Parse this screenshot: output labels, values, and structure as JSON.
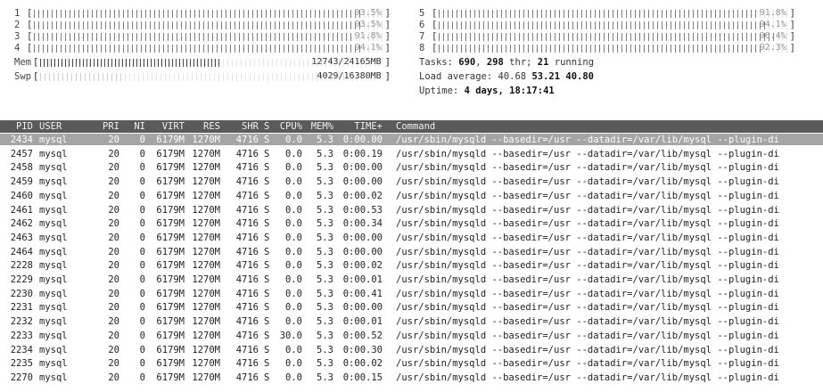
{
  "cpus": [
    {
      "id": "1",
      "pct": "93.5%",
      "fill": 0.935
    },
    {
      "id": "2",
      "pct": "93.5%",
      "fill": 0.935
    },
    {
      "id": "3",
      "pct": "91.8%",
      "fill": 0.918
    },
    {
      "id": "4",
      "pct": "94.1%",
      "fill": 0.941
    },
    {
      "id": "5",
      "pct": "91.8%",
      "fill": 0.918
    },
    {
      "id": "6",
      "pct": "94.1%",
      "fill": 0.941
    },
    {
      "id": "7",
      "pct": "96.4%",
      "fill": 0.964
    },
    {
      "id": "8",
      "pct": "92.3%",
      "fill": 0.923
    }
  ],
  "mem": {
    "label": "Mem",
    "value": "12743/24165MB",
    "fill": 0.527
  },
  "swp": {
    "label": "Swp",
    "value": "4029/16380MB",
    "fill": 0.246
  },
  "tasks": {
    "prefix": "Tasks: ",
    "count": "690",
    "sep": ", ",
    "threads": "298",
    "thr": " thr; ",
    "running": "21",
    "running_label": " running"
  },
  "load": {
    "prefix": "Load average: ",
    "l1": "40.68",
    "l5": "53.21",
    "l15": "40.80"
  },
  "uptime": {
    "prefix": "Uptime: ",
    "value": "4 days, 18:17:41"
  },
  "columns": {
    "pid": "PID",
    "user": "USER",
    "pri": "PRI",
    "ni": "NI",
    "virt": "VIRT",
    "res": "RES",
    "shr": "SHR",
    "s": "S",
    "cpu": "CPU%",
    "mem": "MEM%",
    "time": "TIME+",
    "cmd": "Command"
  },
  "processes": [
    {
      "pid": "2434",
      "user": "mysql",
      "pri": "20",
      "ni": "0",
      "virt": "6179M",
      "res": "1270M",
      "shr": "4716",
      "s": "S",
      "cpu": "0.0",
      "mem": "5.3",
      "time": "0:00.00",
      "cmd": "/usr/sbin/mysqld --basedir=/usr --datadir=/var/lib/mysql --plugin-di"
    },
    {
      "pid": "2457",
      "user": "mysql",
      "pri": "20",
      "ni": "0",
      "virt": "6179M",
      "res": "1270M",
      "shr": "4716",
      "s": "S",
      "cpu": "0.0",
      "mem": "5.3",
      "time": "0:00.19",
      "cmd": "/usr/sbin/mysqld --basedir=/usr --datadir=/var/lib/mysql --plugin-di"
    },
    {
      "pid": "2458",
      "user": "mysql",
      "pri": "20",
      "ni": "0",
      "virt": "6179M",
      "res": "1270M",
      "shr": "4716",
      "s": "S",
      "cpu": "0.0",
      "mem": "5.3",
      "time": "0:00.00",
      "cmd": "/usr/sbin/mysqld --basedir=/usr --datadir=/var/lib/mysql --plugin-di"
    },
    {
      "pid": "2459",
      "user": "mysql",
      "pri": "20",
      "ni": "0",
      "virt": "6179M",
      "res": "1270M",
      "shr": "4716",
      "s": "S",
      "cpu": "0.0",
      "mem": "5.3",
      "time": "0:00.00",
      "cmd": "/usr/sbin/mysqld --basedir=/usr --datadir=/var/lib/mysql --plugin-di"
    },
    {
      "pid": "2460",
      "user": "mysql",
      "pri": "20",
      "ni": "0",
      "virt": "6179M",
      "res": "1270M",
      "shr": "4716",
      "s": "S",
      "cpu": "0.0",
      "mem": "5.3",
      "time": "0:00.02",
      "cmd": "/usr/sbin/mysqld --basedir=/usr --datadir=/var/lib/mysql --plugin-di"
    },
    {
      "pid": "2461",
      "user": "mysql",
      "pri": "20",
      "ni": "0",
      "virt": "6179M",
      "res": "1270M",
      "shr": "4716",
      "s": "S",
      "cpu": "0.0",
      "mem": "5.3",
      "time": "0:00.53",
      "cmd": "/usr/sbin/mysqld --basedir=/usr --datadir=/var/lib/mysql --plugin-di"
    },
    {
      "pid": "2462",
      "user": "mysql",
      "pri": "20",
      "ni": "0",
      "virt": "6179M",
      "res": "1270M",
      "shr": "4716",
      "s": "S",
      "cpu": "0.0",
      "mem": "5.3",
      "time": "0:00.34",
      "cmd": "/usr/sbin/mysqld --basedir=/usr --datadir=/var/lib/mysql --plugin-di"
    },
    {
      "pid": "2463",
      "user": "mysql",
      "pri": "20",
      "ni": "0",
      "virt": "6179M",
      "res": "1270M",
      "shr": "4716",
      "s": "S",
      "cpu": "0.0",
      "mem": "5.3",
      "time": "0:00.00",
      "cmd": "/usr/sbin/mysqld --basedir=/usr --datadir=/var/lib/mysql --plugin-di"
    },
    {
      "pid": "2464",
      "user": "mysql",
      "pri": "20",
      "ni": "0",
      "virt": "6179M",
      "res": "1270M",
      "shr": "4716",
      "s": "S",
      "cpu": "0.0",
      "mem": "5.3",
      "time": "0:00.00",
      "cmd": "/usr/sbin/mysqld --basedir=/usr --datadir=/var/lib/mysql --plugin-di"
    },
    {
      "pid": "2228",
      "user": "mysql",
      "pri": "20",
      "ni": "0",
      "virt": "6179M",
      "res": "1270M",
      "shr": "4716",
      "s": "S",
      "cpu": "0.0",
      "mem": "5.3",
      "time": "0:00.02",
      "cmd": "/usr/sbin/mysqld --basedir=/usr --datadir=/var/lib/mysql --plugin-di"
    },
    {
      "pid": "2229",
      "user": "mysql",
      "pri": "20",
      "ni": "0",
      "virt": "6179M",
      "res": "1270M",
      "shr": "4716",
      "s": "S",
      "cpu": "0.0",
      "mem": "5.3",
      "time": "0:00.01",
      "cmd": "/usr/sbin/mysqld --basedir=/usr --datadir=/var/lib/mysql --plugin-di"
    },
    {
      "pid": "2230",
      "user": "mysql",
      "pri": "20",
      "ni": "0",
      "virt": "6179M",
      "res": "1270M",
      "shr": "4716",
      "s": "S",
      "cpu": "0.0",
      "mem": "5.3",
      "time": "0:00.41",
      "cmd": "/usr/sbin/mysqld --basedir=/usr --datadir=/var/lib/mysql --plugin-di"
    },
    {
      "pid": "2231",
      "user": "mysql",
      "pri": "20",
      "ni": "0",
      "virt": "6179M",
      "res": "1270M",
      "shr": "4716",
      "s": "S",
      "cpu": "0.0",
      "mem": "5.3",
      "time": "0:00.00",
      "cmd": "/usr/sbin/mysqld --basedir=/usr --datadir=/var/lib/mysql --plugin-di"
    },
    {
      "pid": "2232",
      "user": "mysql",
      "pri": "20",
      "ni": "0",
      "virt": "6179M",
      "res": "1270M",
      "shr": "4716",
      "s": "S",
      "cpu": "0.0",
      "mem": "5.3",
      "time": "0:00.01",
      "cmd": "/usr/sbin/mysqld --basedir=/usr --datadir=/var/lib/mysql --plugin-di"
    },
    {
      "pid": "2233",
      "user": "mysql",
      "pri": "20",
      "ni": "0",
      "virt": "6179M",
      "res": "1270M",
      "shr": "4716",
      "s": "S",
      "cpu": "30.0",
      "mem": "5.3",
      "time": "0:00.52",
      "cmd": "/usr/sbin/mysqld --basedir=/usr --datadir=/var/lib/mysql --plugin-di"
    },
    {
      "pid": "2234",
      "user": "mysql",
      "pri": "20",
      "ni": "0",
      "virt": "6179M",
      "res": "1270M",
      "shr": "4716",
      "s": "S",
      "cpu": "0.0",
      "mem": "5.3",
      "time": "0:00.30",
      "cmd": "/usr/sbin/mysqld --basedir=/usr --datadir=/var/lib/mysql --plugin-di"
    },
    {
      "pid": "2235",
      "user": "mysql",
      "pri": "20",
      "ni": "0",
      "virt": "6179M",
      "res": "1270M",
      "shr": "4716",
      "s": "S",
      "cpu": "0.0",
      "mem": "5.3",
      "time": "0:00.02",
      "cmd": "/usr/sbin/mysqld --basedir=/usr --datadir=/var/lib/mysql --plugin-di"
    },
    {
      "pid": "2270",
      "user": "mysql",
      "pri": "20",
      "ni": "0",
      "virt": "6179M",
      "res": "1270M",
      "shr": "4716",
      "s": "S",
      "cpu": "0.0",
      "mem": "5.3",
      "time": "0:00.15",
      "cmd": "/usr/sbin/mysqld --basedir=/usr --datadir=/var/lib/mysql --plugin-di"
    }
  ],
  "selected_index": 0
}
